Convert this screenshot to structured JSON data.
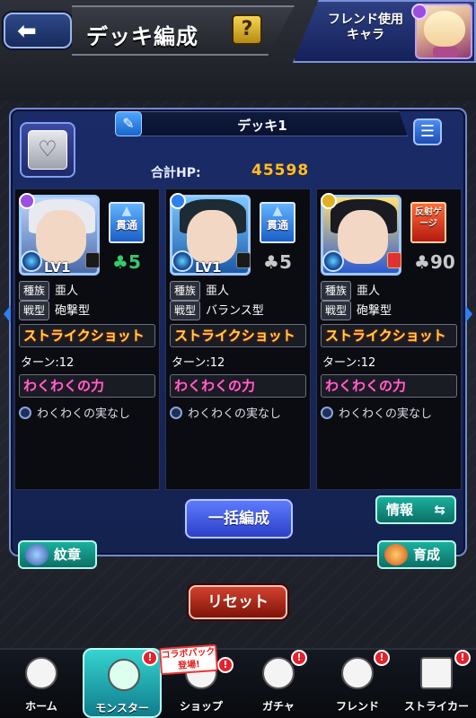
{
  "header": {
    "title": "デッキ編成",
    "help": "?",
    "friend_label_1": "フレンド使用",
    "friend_label_2": "キャラ"
  },
  "deck": {
    "name": "デッキ1",
    "hp_label": "合計HP:",
    "hp_value": "45598"
  },
  "cards": [
    {
      "level": "LV1",
      "ability": "貫通",
      "luck": "5",
      "race_tag": "種族",
      "race": "亜人",
      "type_tag": "戦型",
      "type": "砲撃型",
      "ss": "ストライクショット",
      "turn": "ターン:12",
      "skill": "わくわくの力",
      "fruit": "わくわくの実なし",
      "ability_color": "blue",
      "luck_color": "#39c86a"
    },
    {
      "level": "LV1",
      "ability": "貫通",
      "luck": "5",
      "race_tag": "種族",
      "race": "亜人",
      "type_tag": "戦型",
      "type": "バランス型",
      "ss": "ストライクショット",
      "turn": "ターン:12",
      "skill": "わくわくの力",
      "fruit": "わくわくの実なし",
      "ability_color": "blue",
      "luck_color": "#c8c8c8"
    },
    {
      "level": "",
      "ability": "反射ゲージ",
      "luck": "90",
      "race_tag": "種族",
      "race": "亜人",
      "type_tag": "戦型",
      "type": "砲撃型",
      "ss": "ストライクショット",
      "turn": "ターン:12",
      "skill": "わくわくの力",
      "fruit": "わくわくの実なし",
      "ability_color": "red",
      "luck_color": "#c8c8c8"
    }
  ],
  "buttons": {
    "bulk": "一括編成",
    "info": "情報",
    "emblem": "紋章",
    "grow": "育成",
    "reset": "リセット"
  },
  "nav": {
    "home": "ホーム",
    "monster": "モンスター",
    "shop": "ショップ",
    "gacha": "ガチャ",
    "friend": "フレンド",
    "striker": "ストライカー",
    "collab_1": "コラボパック",
    "collab_2": "登場!",
    "notif": "!"
  }
}
